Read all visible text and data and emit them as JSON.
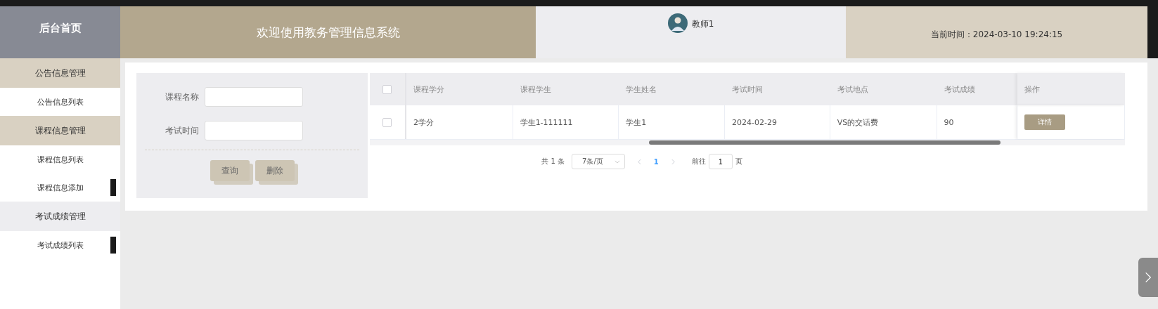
{
  "header": {
    "home": "后台首页",
    "welcome": "欢迎使用教务管理信息系统",
    "user": "教师1",
    "time": "当前时间：2024-03-10 19:24:15"
  },
  "sidebar": [
    {
      "label": "公告信息管理",
      "kind": "group",
      "selected": false,
      "marked": false
    },
    {
      "label": "公告信息列表",
      "kind": "item",
      "selected": false,
      "marked": false
    },
    {
      "label": "课程信息管理",
      "kind": "group",
      "selected": false,
      "marked": false
    },
    {
      "label": "课程信息列表",
      "kind": "item",
      "selected": false,
      "marked": false
    },
    {
      "label": "课程信息添加",
      "kind": "item",
      "selected": false,
      "marked": true
    },
    {
      "label": "考试成绩管理",
      "kind": "group",
      "selected": true,
      "marked": false
    },
    {
      "label": "考试成绩列表",
      "kind": "item",
      "selected": false,
      "marked": true
    }
  ],
  "search": {
    "fields": [
      {
        "label": "课程名称"
      },
      {
        "label": "考试时间"
      }
    ],
    "buttons": [
      "查询",
      "删除"
    ]
  },
  "table": {
    "select_all": false,
    "columns": [
      "课程学分",
      "课程学生",
      "学生姓名",
      "考试时间",
      "考试地点",
      "考试成绩",
      "操作"
    ],
    "rows": [
      {
        "selected": false,
        "cells": [
          "2学分",
          "学生1-111111",
          "学生1",
          "2024-02-29",
          "VS的交话费",
          "90"
        ],
        "action": "详情"
      }
    ]
  },
  "pagination": {
    "total": "共 1 条",
    "page_size": "7条/页",
    "pages": [
      {
        "label": "1",
        "selected": true
      }
    ],
    "goto_label": "前往",
    "goto_value": "1",
    "page_unit": "页"
  }
}
